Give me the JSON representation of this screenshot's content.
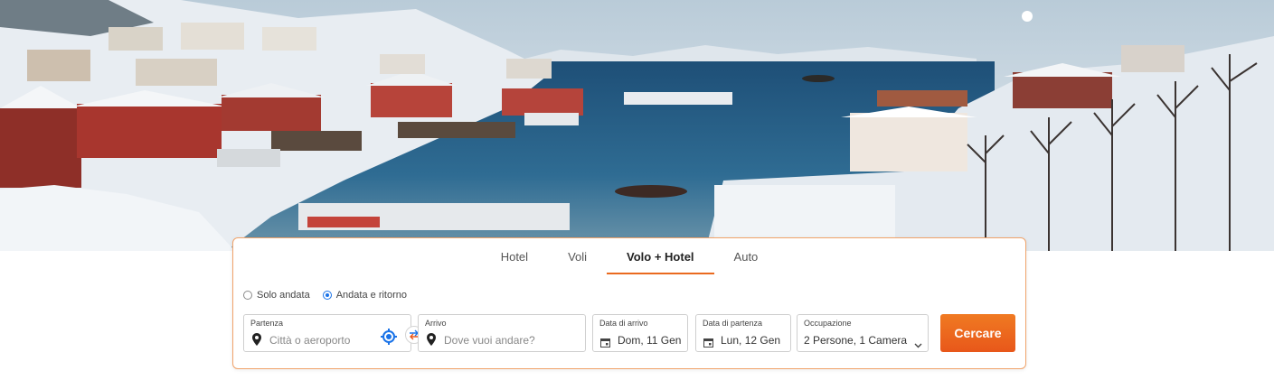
{
  "tabs": [
    {
      "label": "Hotel",
      "active": false
    },
    {
      "label": "Voli",
      "active": false
    },
    {
      "label": "Volo + Hotel",
      "active": true
    },
    {
      "label": "Auto",
      "active": false
    }
  ],
  "trip_type": {
    "one_way": {
      "label": "Solo andata",
      "checked": false
    },
    "round_trip": {
      "label": "Andata e ritorno",
      "checked": true
    }
  },
  "departure": {
    "label": "Partenza",
    "placeholder": "Città o aeroporto",
    "icon": "location-pin-icon",
    "locate_icon": "gps-target-icon"
  },
  "swap": {
    "icon": "swap-arrows-icon"
  },
  "arrival": {
    "label": "Arrivo",
    "placeholder": "Dove vuoi andare?",
    "icon": "location-pin-icon"
  },
  "checkin": {
    "label": "Data di arrivo",
    "value": "Dom, 11 Gen",
    "icon": "calendar-icon"
  },
  "checkout": {
    "label": "Data di partenza",
    "value": "Lun, 12 Gen",
    "icon": "calendar-icon"
  },
  "occupancy": {
    "label": "Occupazione",
    "value": "2 Persone, 1 Camera",
    "icon": "chevron-down-icon"
  },
  "search_button": {
    "label": "Cercare"
  },
  "colors": {
    "accent": "#ea6a1f",
    "radio_active": "#1a73e8",
    "locate_icon": "#1a73e8"
  }
}
